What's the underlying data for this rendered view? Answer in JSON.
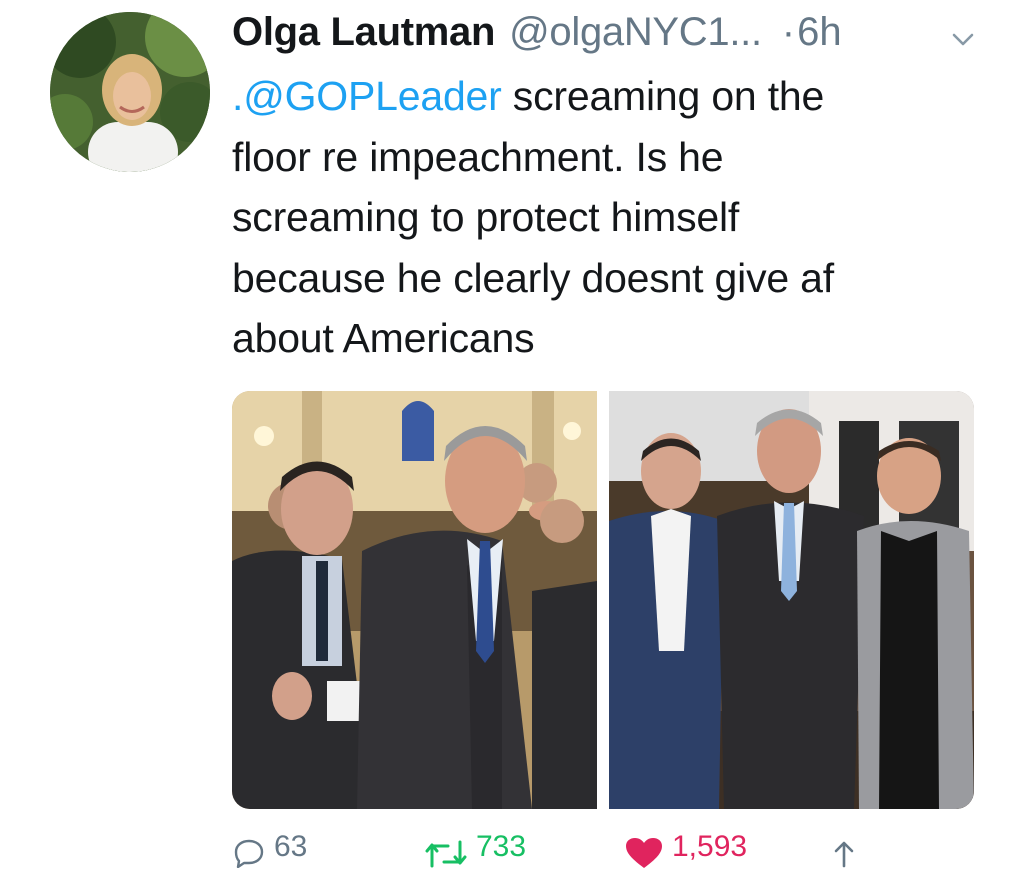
{
  "tweet": {
    "author": {
      "display_name": "Olga Lautman",
      "handle": "@olgaNYC1...",
      "avatar_icon": "profile-photo"
    },
    "separator": "·",
    "timestamp": "6h",
    "text_lines": [
      {
        "mention": ".@GOPLeader",
        "rest": " screaming on the"
      },
      {
        "text": "floor re impeachment. Is he"
      },
      {
        "text": "screaming to protect himself"
      },
      {
        "text": "because he clearly doesnt give af"
      },
      {
        "text": "about Americans"
      }
    ],
    "media": {
      "count": 2,
      "left_photo": "photo of two men in suits posing at an event",
      "right_photo": "photo of three men in suits standing together"
    },
    "actions": {
      "reply_count": "63",
      "retweet_count": "733",
      "like_count": "1,593"
    }
  },
  "colors": {
    "link": "#1da1f2",
    "secondary": "#657786",
    "retweet": "#17bf63",
    "like": "#e0245e",
    "text": "#14171a"
  }
}
